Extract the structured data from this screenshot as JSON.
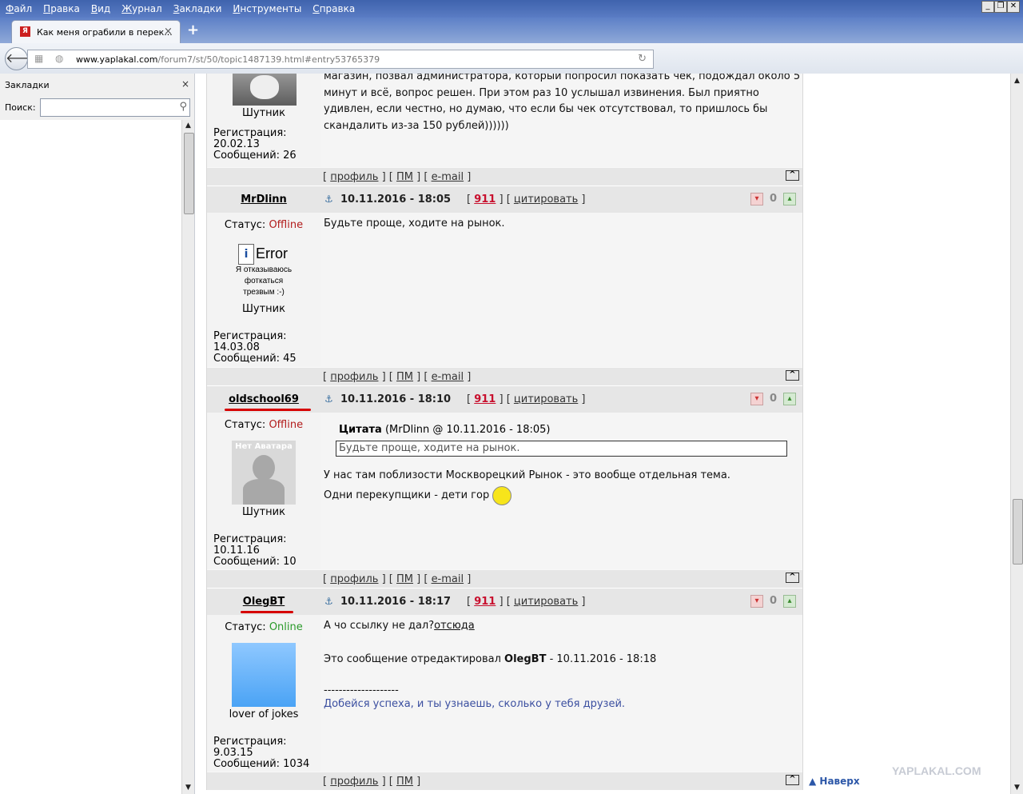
{
  "menu": [
    "Файл",
    "Правка",
    "Вид",
    "Журнал",
    "Закладки",
    "Инструменты",
    "Справка"
  ],
  "window_controls": [
    "_",
    "❐",
    "✕"
  ],
  "tab": {
    "title": "Как меня ограбили в перек...",
    "close": "×",
    "new": "+"
  },
  "nav": {
    "url_host": "www.yaplakal.com",
    "url_path": "/forum7/st/50/topic1487139.html#entry53765379"
  },
  "sidebar": {
    "title": "Закладки",
    "close": "×",
    "search_label": "Поиск:",
    "search_value": ""
  },
  "first_post_tail": {
    "rank": "Шутник",
    "reg_label": "Регистрация:",
    "reg_date": "20.02.13",
    "msgs": "Сообщений: 26",
    "text": [
      "магазин, позвал администратора, который попросил показать чек, подождал около 5",
      "минут и всё, вопрос решен. При этом раз 10 услышал извинения. Был приятно",
      "удивлен, если честно, но думаю, что если бы чек отсутствовал, то пришлось бы",
      "скандалить из-за 150 рублей))))))"
    ]
  },
  "footer_links": {
    "profile": "профиль",
    "pm": "ПМ",
    "email": "e-mail",
    "top": "^"
  },
  "posts": [
    {
      "nick": "MrDlinn",
      "date": "10.11.2016 - 18:05",
      "num": "911",
      "quote_link": "цитировать",
      "rating": "0",
      "status_label": "Статус:",
      "status": "Offline",
      "avatar": {
        "title": "Error",
        "caption": [
          "Я отказываюсь",
          "фоткаться",
          "трезвым :-)"
        ]
      },
      "rank": "Шутник",
      "reg_label": "Регистрация:",
      "reg_date": "14.03.08",
      "msgs": "Сообщений: 45",
      "text": "Будьте проще, ходите на рынок."
    },
    {
      "nick": "oldschool69",
      "date": "10.11.2016 - 18:10",
      "num": "911",
      "quote_link": "цитировать",
      "rating": "0",
      "status_label": "Статус:",
      "status": "Offline",
      "avatar": {
        "title": "Нет Аватара"
      },
      "rank": "Шутник",
      "reg_label": "Регистрация:",
      "reg_date": "10.11.16",
      "msgs": "Сообщений: 10",
      "quote_title": "Цитата",
      "quote_src": "(MrDlinn @ 10.11.2016 - 18:05)",
      "quote_text": "Будьте проще, ходите на рынок.",
      "text": [
        "У нас там поблизости Москворецкий Рынок - это вообще отдельная тема.",
        "Одни перекупщики - дети гор"
      ]
    },
    {
      "nick": "OlegBT",
      "date": "10.11.2016 - 18:17",
      "num": "911",
      "quote_link": "цитировать",
      "rating": "0",
      "status_label": "Статус:",
      "status": "Online",
      "rank": "lover of jokes",
      "reg_label": "Регистрация:",
      "reg_date": "9.03.15",
      "msgs": "Сообщений: 1034",
      "text_a": "А чо ссылку не дал?",
      "text_link": "отсюда",
      "edited_pre": "Это сообщение отредактировал",
      "edited_user": "OlegBT",
      "edited_time": "- 10.11.2016 - 18:18",
      "sig_line": "--------------------",
      "sig": "Добейся успеха, и ты узнаешь, сколько у тебя друзей."
    }
  ],
  "page_nav": {
    "top_link": "▲ Наверх"
  },
  "watermark": "YAPLAKAL.COM",
  "colors": {
    "offline": "#b21c1c",
    "online": "#2a9a2a",
    "link_red": "#c8102e",
    "underline_mark": "#d60000"
  }
}
